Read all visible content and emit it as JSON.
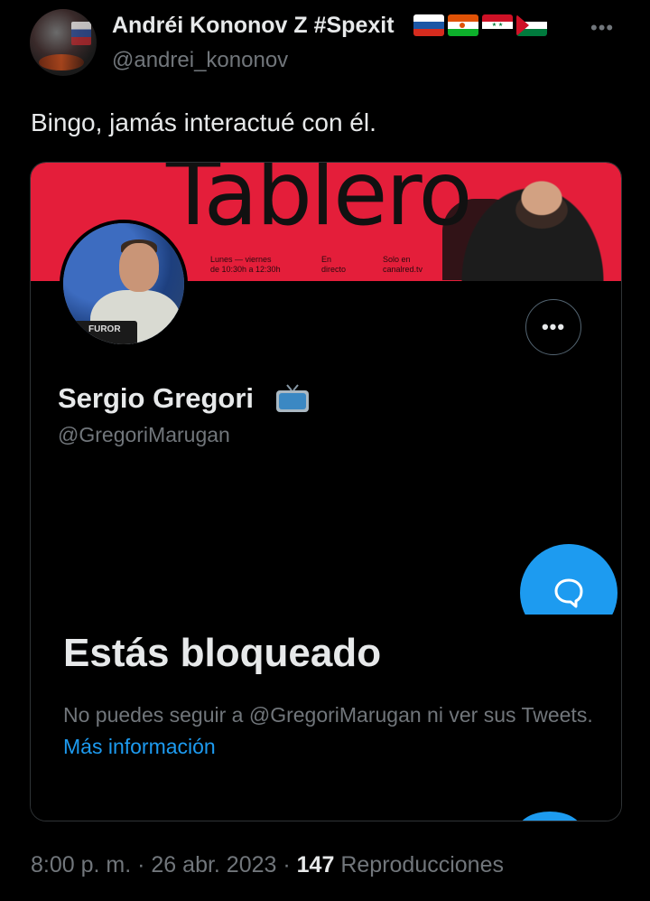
{
  "tweet": {
    "author_name": "Andréi Kononov Z #Spexit",
    "author_handle": "@andrei_kononov",
    "more_label": "•••",
    "text": "Bingo, jamás interactué con él.",
    "time": "8:00 p. m.",
    "separator": "·",
    "date": "26 abr. 2023",
    "views_count": "147",
    "views_label": "Reproducciones"
  },
  "embedded_profile": {
    "banner_title": "Tablero",
    "banner_info": [
      {
        "line1": "Lunes — viernes",
        "line2": "de 10:30h a 12:30h"
      },
      {
        "line1": "En",
        "line2": "directo"
      },
      {
        "line1": "Solo en",
        "line2": "canalred.tv"
      }
    ],
    "avatar_label": "FUROR",
    "more_label": "•••",
    "name": "Sergio Gregori",
    "handle": "@GregoriMarugan",
    "blocked_title": "Estás bloqueado",
    "blocked_text": "No puedes seguir a @GregoriMarugan ni ver sus Tweets.",
    "blocked_link": "Más información"
  },
  "colors": {
    "background": "#000000",
    "text_primary": "#e7e9ea",
    "text_secondary": "#71767b",
    "accent": "#1d9bf0",
    "banner": "#e41e3a"
  },
  "icons": [
    "author-avatar",
    "flag-russia-icon",
    "flag-niger-icon",
    "flag-syria-icon",
    "flag-palestine-icon",
    "tv-icon",
    "message-bubble-icon"
  ]
}
